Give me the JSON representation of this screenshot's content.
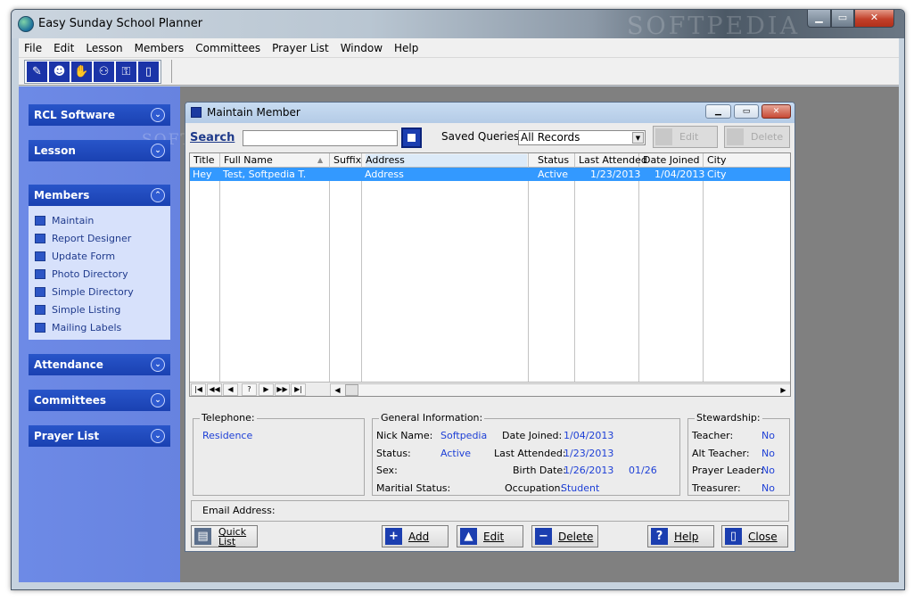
{
  "window": {
    "title": "Easy Sunday School Planner",
    "watermark": "SOFTPEDIA"
  },
  "menu": [
    "File",
    "Edit",
    "Lesson",
    "Members",
    "Committees",
    "Prayer List",
    "Window",
    "Help"
  ],
  "toolbar_icons": [
    "members-edit-icon",
    "person-icon",
    "handshake-icon",
    "people-icon",
    "lock-icon",
    "door-exit-icon"
  ],
  "nav": {
    "watermark": "SOFTPEDIA",
    "sections": [
      {
        "label": "RCL Software"
      },
      {
        "label": "Lesson"
      },
      {
        "label": "Members"
      },
      {
        "label": "Attendance"
      },
      {
        "label": "Committees"
      },
      {
        "label": "Prayer List"
      }
    ],
    "members_items": [
      "Maintain",
      "Report Designer",
      "Update Form",
      "Photo Directory",
      "Simple Directory",
      "Simple Listing",
      "Mailing Labels"
    ]
  },
  "dialog": {
    "title": "Maintain Member",
    "search_label": "Search",
    "search_value": "",
    "saved_queries_label": "Saved Queries:",
    "saved_queries_value": "All Records",
    "edit_label": "Edit",
    "delete_label": "Delete",
    "grid": {
      "columns": [
        "Title",
        "Full Name",
        "Suffix",
        "Address",
        "Status",
        "Last Attended",
        "Date Joined",
        "City"
      ],
      "rows": [
        [
          "Hey",
          "Test, Softpedia T.",
          "",
          "Address",
          "Active",
          "1/23/2013",
          "1/04/2013",
          "City"
        ]
      ],
      "nav_buttons": [
        "|◀",
        "◀◀",
        "◀",
        "?",
        "▶",
        "▶▶",
        "▶|"
      ]
    },
    "telephone": {
      "caption": "Telephone:",
      "residence": "Residence"
    },
    "general": {
      "caption": "General Information:",
      "nick_name_label": "Nick Name:",
      "nick_name": "Softpedia",
      "status_label": "Status:",
      "status": "Active",
      "sex_label": "Sex:",
      "marital_label": "Maritial Status:",
      "date_joined_label": "Date Joined:",
      "date_joined": "1/04/2013",
      "last_attended_label": "Last Attended:",
      "last_attended": "1/23/2013",
      "birth_date_label": "Birth Date:",
      "birth_date": "1/26/2013",
      "birth_short": "01/26",
      "occupation_label": "Occupation:",
      "occupation": "Student"
    },
    "stewardship": {
      "caption": "Stewardship:",
      "teacher_label": "Teacher:",
      "teacher": "No",
      "alt_teacher_label": "Alt Teacher:",
      "alt_teacher": "No",
      "prayer_leader_label": "Prayer Leader:",
      "prayer_leader": "No",
      "treasurer_label": "Treasurer:",
      "treasurer": "No"
    },
    "email_label": "Email Address:",
    "buttons": {
      "quick": "Quick",
      "list": "List",
      "add": "Add",
      "edit": "Edit",
      "delete": "Delete",
      "help": "Help",
      "close": "Close"
    }
  }
}
